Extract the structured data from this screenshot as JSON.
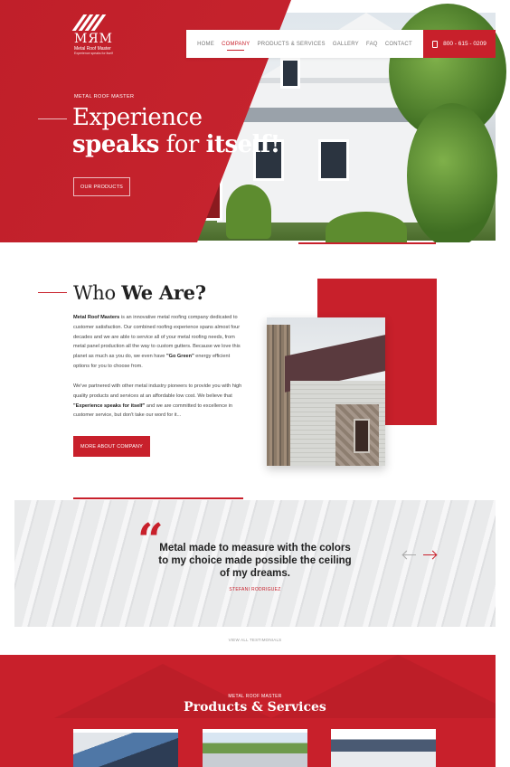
{
  "brand": {
    "mark": "MЯM",
    "name": "Metal Roof Master",
    "tagline": "Experience speaks for itself"
  },
  "nav": {
    "items": [
      "HOME",
      "COMPANY",
      "PRODUCTS & SERVICES",
      "GALLERY",
      "FAQ",
      "CONTACT"
    ],
    "active": "COMPANY",
    "phone": "800 - 615 - 0209"
  },
  "hero": {
    "kicker": "METAL ROOF MASTER",
    "title_line1": "Experience",
    "title_line2_bold1": "speaks",
    "title_line2_mid": " for ",
    "title_line2_bold2": "itself!",
    "button": "OUR PRODUCTS"
  },
  "who": {
    "title_light": "Who ",
    "title_bold": "We Are?",
    "p1_bold": "Metal Roof Masters",
    "p1_text": " is an innovative metal roofing company dedicated to customer satisfaction. Our combined roofing experience spans almost four decades and we are able to service all of your metal roofing needs, from metal panel production all the way to custom gutters. Because we love this planet as much as you do, we even have ",
    "p1_bold2": "\"Go Green\"",
    "p1_text2": " energy efficient options for you to choose from.",
    "p2_text": "We've partnered with other metal industry pioneers to provide you with high quality products and services at an affordable low cost. We believe that ",
    "p2_bold": "\"Experience speaks for itself\"",
    "p2_text2": " and we are committed to excellence in customer service, but don't take our word for it...",
    "button": "MORE ABOUT COMPANY"
  },
  "testimonial": {
    "quote_mark": "“",
    "quote": "Metal made to measure with the colors to my choice made possible the ceiling of my dreams.",
    "author": "STEFANI RODRIGUEZ",
    "view_all": "VIEW ALL TESTIMONIALS"
  },
  "products": {
    "kicker": "METAL ROOF MASTER",
    "title_bold": "Products",
    "title_light": " & Services"
  },
  "colors": {
    "accent": "#c8202b"
  }
}
